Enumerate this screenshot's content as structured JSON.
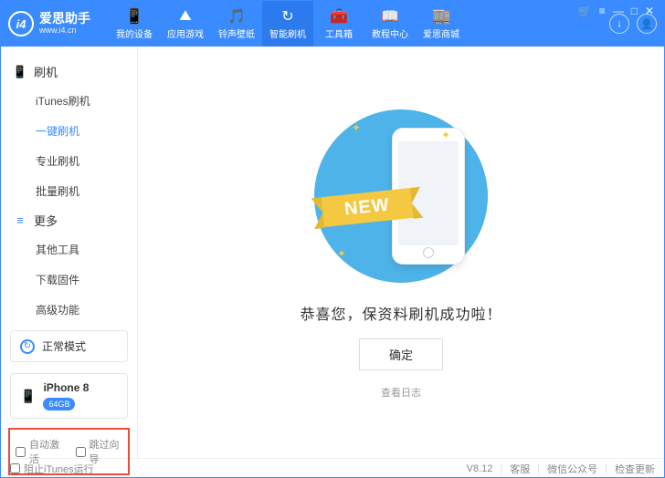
{
  "brand": {
    "name": "爱思助手",
    "url": "www.i4.cn",
    "logo_text": "i4"
  },
  "nav": [
    {
      "label": "我的设备",
      "icon": "📱"
    },
    {
      "label": "应用游戏",
      "icon": "⛰"
    },
    {
      "label": "铃声壁纸",
      "icon": "🎵"
    },
    {
      "label": "智能刷机",
      "icon": "↻",
      "active": true
    },
    {
      "label": "工具箱",
      "icon": "🧰"
    },
    {
      "label": "教程中心",
      "icon": "📖"
    },
    {
      "label": "爱思商城",
      "icon": "🏬"
    }
  ],
  "right_icons": {
    "download": "↓",
    "user": "👤"
  },
  "win_controls": {
    "cart": "🛒",
    "menu": "≡",
    "min": "—",
    "max": "□",
    "close": "✕"
  },
  "sidebar": {
    "group1": {
      "title": "刷机",
      "icon": "📱",
      "items": [
        "iTunes刷机",
        "一键刷机",
        "专业刷机",
        "批量刷机"
      ],
      "activeIndex": 1
    },
    "group2": {
      "title": "更多",
      "icon": "≡",
      "items": [
        "其他工具",
        "下载固件",
        "高级功能"
      ]
    },
    "mode": {
      "label": "正常模式",
      "icon": "↻"
    },
    "device": {
      "name": "iPhone 8",
      "storage": "64GB"
    },
    "checkboxes": {
      "auto_activate": "自动激活",
      "skip_guide": "跳过向导"
    }
  },
  "main": {
    "ribbon": "NEW",
    "message": "恭喜您，保资料刷机成功啦！",
    "confirm": "确定",
    "log_link": "查看日志"
  },
  "footer": {
    "block_itunes": "阻止iTunes运行",
    "version": "V8.12",
    "links": [
      "客服",
      "微信公众号",
      "检查更新"
    ]
  }
}
